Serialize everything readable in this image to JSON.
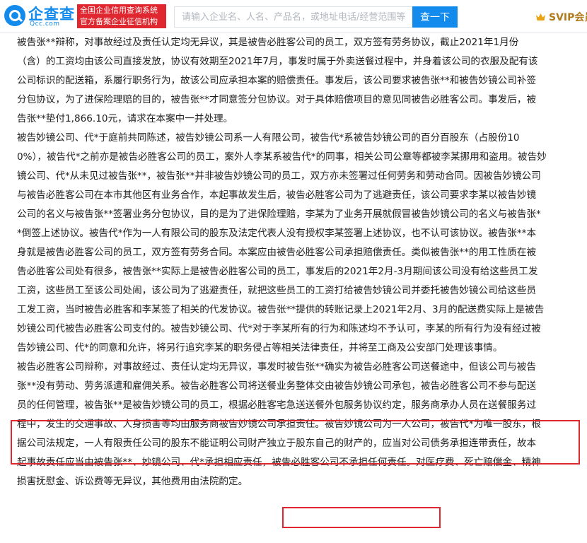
{
  "header": {
    "brand_name": "企查查",
    "brand_domain": "Qcc.com",
    "slogan_line1": "全国企业信用查询系统",
    "slogan_line2": "官方备案企业征信机构",
    "search_placeholder": "请输入企业名、人名、产品名，或地址电话/经营范围等",
    "search_button": "查一下",
    "svip_label": "SVIP会员",
    "colors": {
      "brand": "#128bed",
      "slogan_bg": "#e0262e",
      "svip": "#b07b1c"
    }
  },
  "document": {
    "paragraphs": [
      {
        "lines": [
          "被告张**辩称，对事故经过及责任认定均无异议，其是被告必胜客公司的员工，双方签有劳务协议，截止2021年1月份",
          "（含）的工资均由该公司直接发放，协议有效期至2021年7月，事发时属于外卖送餐过程中，并身着该公司的衣服及配有该",
          "公司标识的配送箱，系履行职务行为，故该公司应承担本案的赔偿责任。事发后，该公司要求被告张**和被告妙镜公司补签",
          "分包协议，为了进保险理赔的目的，被告张**才同意签分包协议。对于具体赔偿项目的意见同被告必胜客公司。事发后，被",
          "告张**垫付1,866.10元，请求在本案中一并处理。"
        ]
      },
      {
        "lines": [
          "被告妙镜公司、代*于庭前共同陈述，被告妙镜公司系一人有限公司，被告代*系被告妙镜公司的百分百股东（占股份10",
          "0%），被告代*之前亦是被告必胜客公司的员工，案外人李某系被告代*的同事，相关公司公章等都被李某挪用和盗用。被告妙",
          "镜公司、代*从未见过被告张**，被告张**并非被告妙镜公司的员工，双方亦未签署过任何劳务和劳动合同。因被告妙镜公司",
          "与被告必胜客公司在本市其他区有业务合作，本起事故发生后，被告必胜客公司为了逃避责任，该公司要求李某以被告妙镜",
          "公司的名义与被告张**签署业务分包协议，目的是为了进保险理赔，李某为了业务开展就假冒被告妙镜公司的名义与被告张*",
          "*倒签上述协议。被告代*作为一人有限公司的股东及法定代表人没有授权李某签署上述协议，也不认可该协议。被告张**本",
          "身就是被告必胜客公司的员工，双方签有劳务合同。本案应由被告必胜客公司承担赔偿责任。类似被告张**的用工性质在被",
          "告必胜客公司处有很多，被告张**实际上是被告必胜客公司的员工，事发后的2021年2月-3月期间该公司没有给这些员工发",
          "工资，这些员工至该公司处闹，该公司为了逃避责任，就把这些员工的工资打给被告妙镜公司并委托被告妙镜公司给这些员",
          "工发工资，当时被告必胜客和李某签了相关的代发协议。被告张**提供的转账记录上2021年2月、3月的配送费实际上是被告",
          "妙镜公司代被告必胜客公司支付的。被告妙镜公司、代*对于李某所有的行为和陈述均不予认可，李某的所有行为没有经过被",
          "告妙镜公司、代*的同意和允许，将另行追究李某的职务侵占等相关法律责任，并将至工商及公安部门处理该事情。"
        ]
      },
      {
        "lines": [
          "被告必胜客公司辩称，对事故经过、责任认定均无异议，事发时被告张**确实为被告必胜客公司送餐途中，但该公司与被告",
          "张**没有劳动、劳务派遣和雇佣关系。被告必胜客公司将送餐业务整体交由被告妙镜公司承包，被告必胜客公司不参与配送",
          "员的任何管理，被告张**是被告妙镜公司的员工，根据必胜客宅急送送餐外包服务协议约定，服务商承办人员在送餐服务过",
          "程中，发生的交通事故、人身损害等均由服务商被告妙镜公司承担责任。被告妙镜公司为一人公司，被告代*为唯一股东，根",
          "据公司法规定，一人有限责任公司的股东不能证明公司财产独立于股东自己的财产的，应当对公司债务承担连带责任，故本",
          "起事故责任应当由被告张**、妙镜公司、代*承担相应责任，被告必胜客公司不承担任何责任。对医疗费、死亡赔偿金、精神",
          "损害抚慰金、诉讼费等无异议，其他费用由法院酌定。"
        ]
      }
    ]
  }
}
